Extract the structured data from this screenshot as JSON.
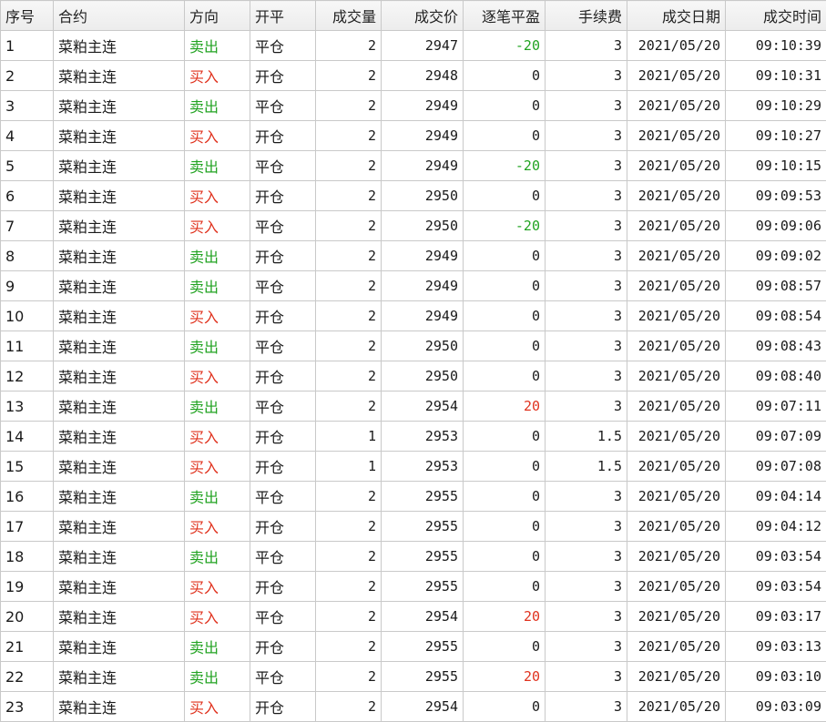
{
  "columns": [
    "序号",
    "合约",
    "方向",
    "开平",
    "成交量",
    "成交价",
    "逐笔平盈",
    "手续费",
    "成交日期",
    "成交时间"
  ],
  "colors": {
    "sell": "#22a322",
    "buy": "#e0321e",
    "header_bg": "#ececec",
    "grid": "#c9c9c9"
  },
  "rows": [
    {
      "id": "1",
      "contract": "菜粕主连",
      "side": "卖出",
      "openclose": "平仓",
      "qty": "2",
      "price": "2947",
      "pnl": "-20",
      "fee": "3",
      "date": "2021/05/20",
      "time": "09:10:39"
    },
    {
      "id": "2",
      "contract": "菜粕主连",
      "side": "买入",
      "openclose": "开仓",
      "qty": "2",
      "price": "2948",
      "pnl": "0",
      "fee": "3",
      "date": "2021/05/20",
      "time": "09:10:31"
    },
    {
      "id": "3",
      "contract": "菜粕主连",
      "side": "卖出",
      "openclose": "平仓",
      "qty": "2",
      "price": "2949",
      "pnl": "0",
      "fee": "3",
      "date": "2021/05/20",
      "time": "09:10:29"
    },
    {
      "id": "4",
      "contract": "菜粕主连",
      "side": "买入",
      "openclose": "开仓",
      "qty": "2",
      "price": "2949",
      "pnl": "0",
      "fee": "3",
      "date": "2021/05/20",
      "time": "09:10:27"
    },
    {
      "id": "5",
      "contract": "菜粕主连",
      "side": "卖出",
      "openclose": "平仓",
      "qty": "2",
      "price": "2949",
      "pnl": "-20",
      "fee": "3",
      "date": "2021/05/20",
      "time": "09:10:15"
    },
    {
      "id": "6",
      "contract": "菜粕主连",
      "side": "买入",
      "openclose": "开仓",
      "qty": "2",
      "price": "2950",
      "pnl": "0",
      "fee": "3",
      "date": "2021/05/20",
      "time": "09:09:53"
    },
    {
      "id": "7",
      "contract": "菜粕主连",
      "side": "买入",
      "openclose": "平仓",
      "qty": "2",
      "price": "2950",
      "pnl": "-20",
      "fee": "3",
      "date": "2021/05/20",
      "time": "09:09:06"
    },
    {
      "id": "8",
      "contract": "菜粕主连",
      "side": "卖出",
      "openclose": "开仓",
      "qty": "2",
      "price": "2949",
      "pnl": "0",
      "fee": "3",
      "date": "2021/05/20",
      "time": "09:09:02"
    },
    {
      "id": "9",
      "contract": "菜粕主连",
      "side": "卖出",
      "openclose": "平仓",
      "qty": "2",
      "price": "2949",
      "pnl": "0",
      "fee": "3",
      "date": "2021/05/20",
      "time": "09:08:57"
    },
    {
      "id": "10",
      "contract": "菜粕主连",
      "side": "买入",
      "openclose": "开仓",
      "qty": "2",
      "price": "2949",
      "pnl": "0",
      "fee": "3",
      "date": "2021/05/20",
      "time": "09:08:54"
    },
    {
      "id": "11",
      "contract": "菜粕主连",
      "side": "卖出",
      "openclose": "平仓",
      "qty": "2",
      "price": "2950",
      "pnl": "0",
      "fee": "3",
      "date": "2021/05/20",
      "time": "09:08:43"
    },
    {
      "id": "12",
      "contract": "菜粕主连",
      "side": "买入",
      "openclose": "开仓",
      "qty": "2",
      "price": "2950",
      "pnl": "0",
      "fee": "3",
      "date": "2021/05/20",
      "time": "09:08:40"
    },
    {
      "id": "13",
      "contract": "菜粕主连",
      "side": "卖出",
      "openclose": "平仓",
      "qty": "2",
      "price": "2954",
      "pnl": "20",
      "fee": "3",
      "date": "2021/05/20",
      "time": "09:07:11"
    },
    {
      "id": "14",
      "contract": "菜粕主连",
      "side": "买入",
      "openclose": "开仓",
      "qty": "1",
      "price": "2953",
      "pnl": "0",
      "fee": "1.5",
      "date": "2021/05/20",
      "time": "09:07:09"
    },
    {
      "id": "15",
      "contract": "菜粕主连",
      "side": "买入",
      "openclose": "开仓",
      "qty": "1",
      "price": "2953",
      "pnl": "0",
      "fee": "1.5",
      "date": "2021/05/20",
      "time": "09:07:08"
    },
    {
      "id": "16",
      "contract": "菜粕主连",
      "side": "卖出",
      "openclose": "平仓",
      "qty": "2",
      "price": "2955",
      "pnl": "0",
      "fee": "3",
      "date": "2021/05/20",
      "time": "09:04:14"
    },
    {
      "id": "17",
      "contract": "菜粕主连",
      "side": "买入",
      "openclose": "开仓",
      "qty": "2",
      "price": "2955",
      "pnl": "0",
      "fee": "3",
      "date": "2021/05/20",
      "time": "09:04:12"
    },
    {
      "id": "18",
      "contract": "菜粕主连",
      "side": "卖出",
      "openclose": "平仓",
      "qty": "2",
      "price": "2955",
      "pnl": "0",
      "fee": "3",
      "date": "2021/05/20",
      "time": "09:03:54"
    },
    {
      "id": "19",
      "contract": "菜粕主连",
      "side": "买入",
      "openclose": "开仓",
      "qty": "2",
      "price": "2955",
      "pnl": "0",
      "fee": "3",
      "date": "2021/05/20",
      "time": "09:03:54"
    },
    {
      "id": "20",
      "contract": "菜粕主连",
      "side": "买入",
      "openclose": "平仓",
      "qty": "2",
      "price": "2954",
      "pnl": "20",
      "fee": "3",
      "date": "2021/05/20",
      "time": "09:03:17"
    },
    {
      "id": "21",
      "contract": "菜粕主连",
      "side": "卖出",
      "openclose": "开仓",
      "qty": "2",
      "price": "2955",
      "pnl": "0",
      "fee": "3",
      "date": "2021/05/20",
      "time": "09:03:13"
    },
    {
      "id": "22",
      "contract": "菜粕主连",
      "side": "卖出",
      "openclose": "平仓",
      "qty": "2",
      "price": "2955",
      "pnl": "20",
      "fee": "3",
      "date": "2021/05/20",
      "time": "09:03:10"
    },
    {
      "id": "23",
      "contract": "菜粕主连",
      "side": "买入",
      "openclose": "开仓",
      "qty": "2",
      "price": "2954",
      "pnl": "0",
      "fee": "3",
      "date": "2021/05/20",
      "time": "09:03:09"
    }
  ]
}
